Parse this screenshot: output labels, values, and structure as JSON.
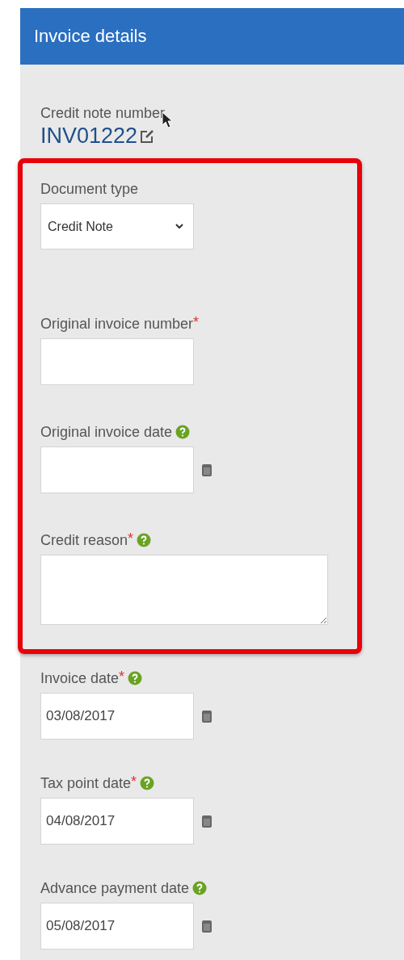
{
  "header": {
    "title": "Invoice details"
  },
  "number": {
    "label": "Credit note number",
    "value": "INV01222"
  },
  "highlighted_fields": [
    {
      "kind": "select",
      "label": "Document type",
      "value": "Credit Note",
      "help": false
    },
    {
      "kind": "text",
      "label": "Original invoice number",
      "required_mark": "*",
      "help": false
    },
    {
      "kind": "date",
      "label": "Original invoice date",
      "help": true
    },
    {
      "kind": "textarea",
      "label": "Credit reason",
      "required_mark": "*",
      "help": true
    }
  ],
  "fields": [
    {
      "kind": "date",
      "label": "Invoice date",
      "value": "03/08/2017",
      "required_mark": "*",
      "help": true
    },
    {
      "kind": "date",
      "label": "Tax point date",
      "value": "04/08/2017",
      "required_mark": "*",
      "help": true
    },
    {
      "kind": "date",
      "label": "Advance payment date",
      "value": "05/08/2017",
      "help": true
    }
  ]
}
